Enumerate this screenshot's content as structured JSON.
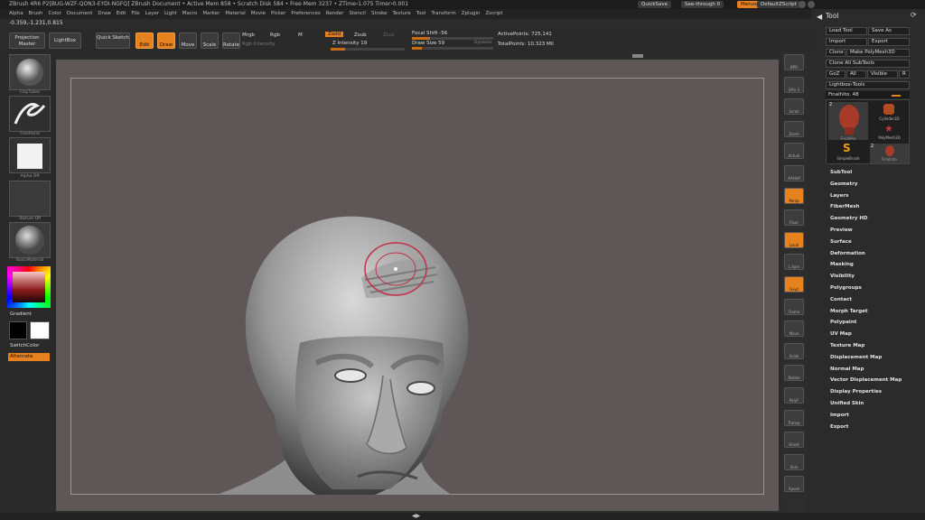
{
  "titlebar": {
    "title": "ZBrush 4R6 P2[BUG-WZF-QON3-EYDI-NGFQ]   ZBrush Document   • Active Mem 858 • Scratch Disk 584 • Free Mem 3237 • ZTime›1.075 Timer›0.001",
    "quicksave": "QuickSave",
    "see_through": "See-through  0",
    "menus": "Menus",
    "default_zscript": "DefaultZScript"
  },
  "menubar": {
    "items": [
      "Alpha",
      "Brush",
      "Color",
      "Document",
      "Draw",
      "Edit",
      "File",
      "Layer",
      "Light",
      "Macro",
      "Marker",
      "Material",
      "Movie",
      "Picker",
      "Preferences",
      "Render",
      "Stencil",
      "Stroke",
      "Texture",
      "Tool",
      "Transform",
      "Zplugin",
      "Zscript"
    ]
  },
  "coords": "-0.359,-1.231,0.815",
  "toolbar": {
    "projection_master": "Projection Master",
    "lightbox": "LightBox",
    "quick_sketch": "Quick Sketch",
    "edit": "Edit",
    "draw": "Draw",
    "move": "Move",
    "scale": "Scale",
    "rotate": "Rotate",
    "mrgb": "Mrgb",
    "rgb": "Rgb",
    "m": "M",
    "rgb_intensity": "Rgb Intensity",
    "zadd": "Zadd",
    "zsub": "Zsub",
    "zcut": "Zcut",
    "z_intensity": "Z Intensity 19",
    "focal_shift": "Focal Shift -56",
    "draw_size": "Draw Size 59",
    "dynamic": "Dynamic",
    "active_points": "ActivePoints: 725,141",
    "total_points": "TotalPoints: 10.323 Mil"
  },
  "toolbar_levels": {
    "z_intensity": 0.19,
    "focal_shift": 0.22,
    "draw_size": 0.12
  },
  "leftshelf": {
    "brush_label": "ClayTubes",
    "stroke_label": "FreeHand",
    "alpha_label": "Alpha Off",
    "texture_label": "Texture Off",
    "material_label": "BasicMaterial",
    "gradient": "Gradient",
    "switchcolor": "SwitchColor",
    "alternate": "Alternate"
  },
  "rightshelf": {
    "items": [
      "BPR",
      "SPix 3",
      "Scroll",
      "Zoom",
      "Actual",
      "AAHalf",
      "Persp",
      "Floor",
      "Local",
      "L.Sym",
      "Gxyz",
      "Frame",
      "Move",
      "Scale",
      "Rotate",
      "PolyF",
      "Transp",
      "Ghost",
      "Solo",
      "Xpose"
    ]
  },
  "palette": {
    "title": "Tool",
    "load_tool": "Load Tool",
    "save_as": "Save As",
    "import": "Import",
    "export": "Export",
    "clone": "Clone",
    "make_polymesh": "Make PolyMesh3D",
    "clone_all": "Clone All SubTools",
    "goz": "GoZ",
    "all": "All",
    "visible": "Visible",
    "r": "R",
    "lightbox_tools": "Lightbox›Tools",
    "finalhito": "Finalhito. 48",
    "tools": [
      {
        "name": "Finalhito",
        "count": "2"
      },
      {
        "name": "Cylinder3D",
        "count": ""
      },
      {
        "name": "PolyMesh3D",
        "count": ""
      },
      {
        "name": "SimpleBrush",
        "count": ""
      },
      {
        "name": "Finalhito",
        "count": "2"
      }
    ],
    "subpalettes": [
      "SubTool",
      "Geometry",
      "Layers",
      "FiberMesh",
      "Geometry HD",
      "Preview",
      "Surface",
      "Deformation",
      "Masking",
      "Visibility",
      "Polygroups",
      "Contact",
      "Morph Target",
      "Polypaint",
      "UV Map",
      "Texture Map",
      "Displacement Map",
      "Normal Map",
      "Vector Displacement Map",
      "Display Properties",
      "Unified Skin",
      "Import",
      "Export"
    ]
  },
  "colors": {
    "accent": "#e6811d",
    "canvas": "#5f5757",
    "ui_bg": "#2b2b2b"
  }
}
